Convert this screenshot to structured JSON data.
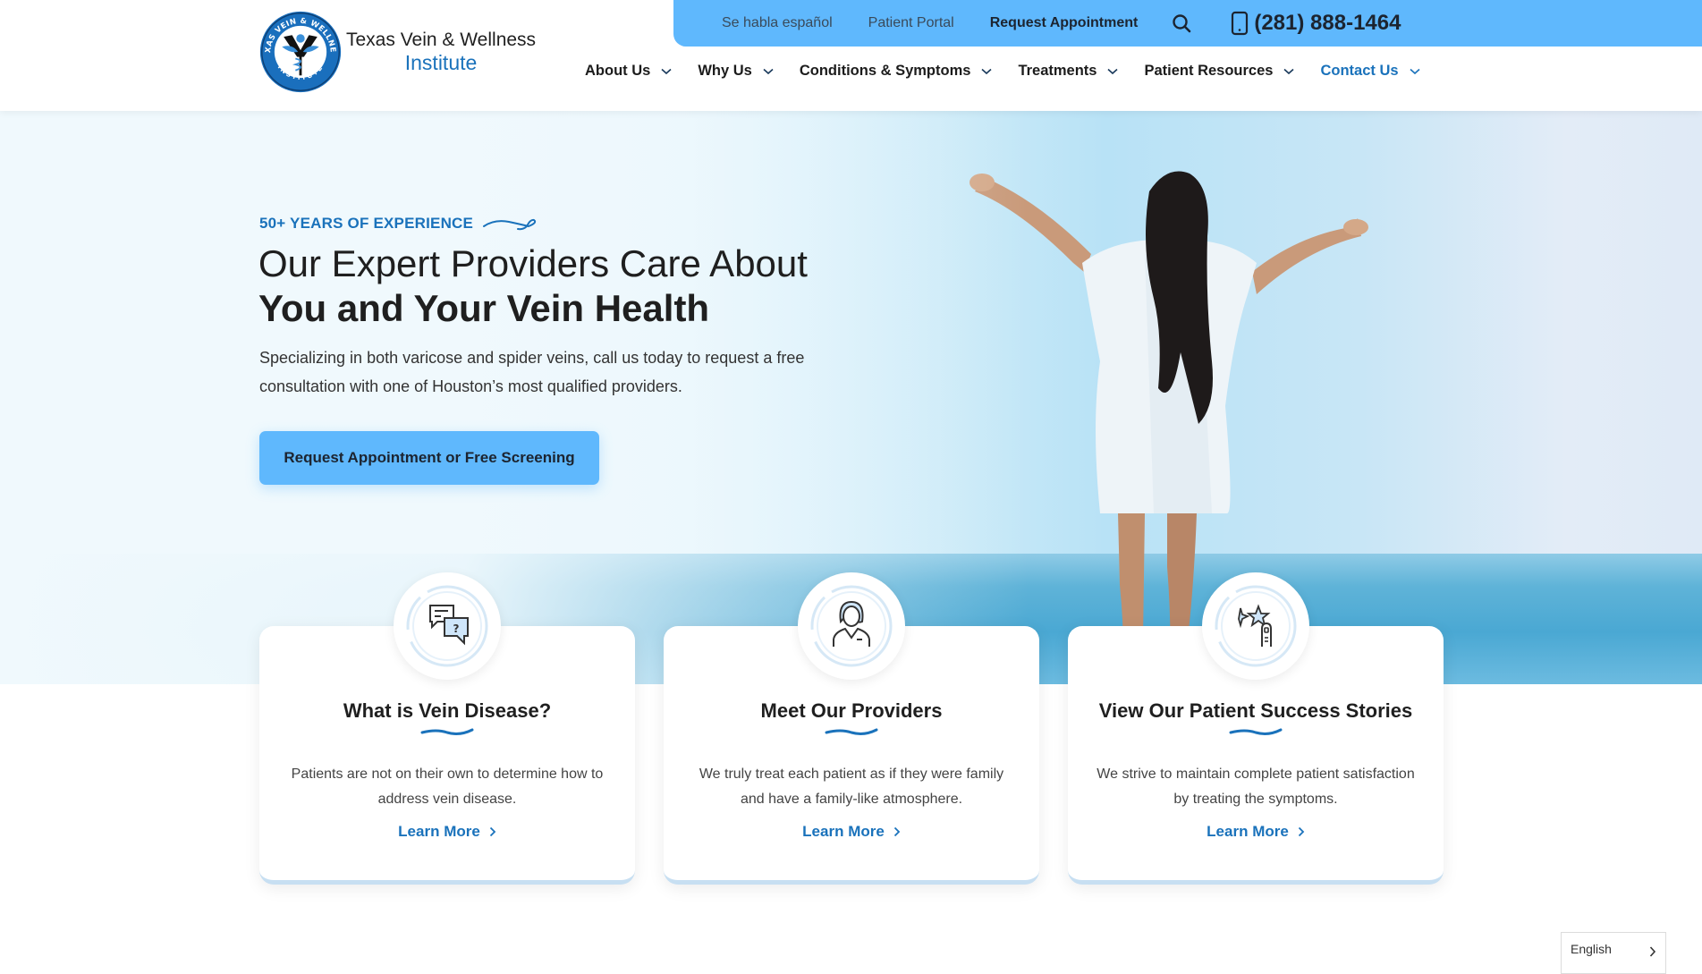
{
  "brand": {
    "name_line1": "Texas Vein & Wellness",
    "name_line2": "Institute",
    "seal_text_top": "TEXAS VEIN & WELLNESS",
    "seal_text_bottom": "INSTITUTE",
    "primary_color": "#1a72bb",
    "accent_color": "#5fb8fd"
  },
  "topbar": {
    "links": [
      {
        "label": "Se habla español"
      },
      {
        "label": "Patient Portal"
      },
      {
        "label": "Request Appointment"
      }
    ],
    "search_icon": "search-icon",
    "phone_icon": "mobile-phone-icon",
    "phone": "(281) 888-1464"
  },
  "nav": {
    "items": [
      {
        "label": "About Us",
        "icon": "chevron-down-icon"
      },
      {
        "label": "Why Us",
        "icon": "chevron-down-icon"
      },
      {
        "label": "Conditions & Symptoms",
        "icon": "chevron-down-icon"
      },
      {
        "label": "Treatments",
        "icon": "chevron-down-icon"
      },
      {
        "label": "Patient Resources",
        "icon": "chevron-down-icon"
      },
      {
        "label": "Contact Us",
        "icon": "chevron-down-icon",
        "active": true
      }
    ]
  },
  "hero": {
    "tagline": "50+ YEARS OF EXPERIENCE",
    "heading_line1": "Our Expert Providers Care About",
    "heading_line2": "You and Your Vein Health",
    "lead": "Specializing in both varicose and spider veins, call us today to request a free consultation with one of Houston’s most qualified providers.",
    "cta": "Request Appointment or Free Screening",
    "image_alt": "Woman in white dress with arms outstretched by the ocean"
  },
  "cards": [
    {
      "icon": "chat-question-icon",
      "title": "What is Vein Disease?",
      "description": "Patients are not on their own to determine how to address vein disease.",
      "link": "Learn More"
    },
    {
      "icon": "female-doctor-icon",
      "title": "Meet Our Providers",
      "description": "We truly treat each patient as if they were family and have a family-like atmosphere.",
      "link": "Learn More"
    },
    {
      "icon": "stars-rating-icon",
      "title": "View Our Patient Success Stories",
      "description": "We strive to maintain complete patient satisfaction by treating the symptoms.",
      "link": "Learn More"
    }
  ],
  "language": {
    "selected": "English"
  }
}
